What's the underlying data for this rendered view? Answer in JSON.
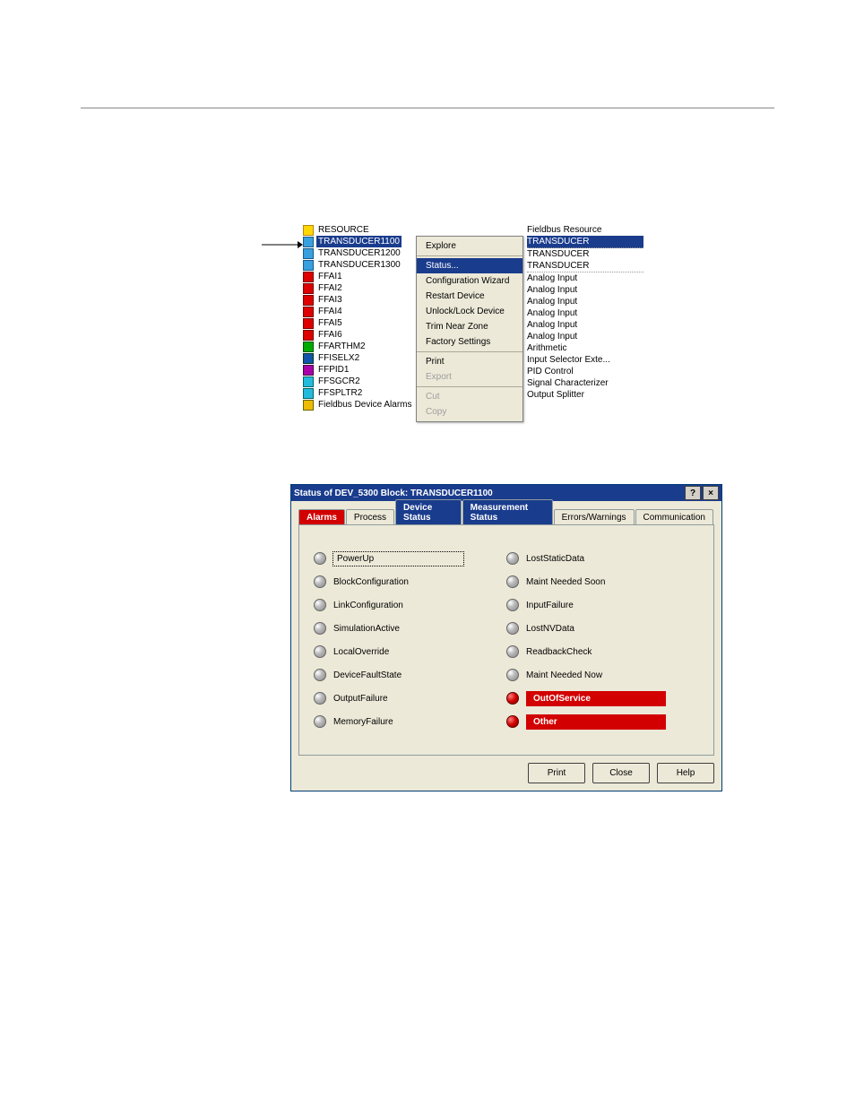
{
  "tree": {
    "items": [
      {
        "label": "RESOURCE",
        "icon": "ic-folder",
        "type": "Fieldbus Resource",
        "tsel": false,
        "sel": false,
        "dot": false
      },
      {
        "label": "TRANSDUCER1100",
        "icon": "ic-block",
        "type": "TRANSDUCER",
        "tsel": true,
        "sel": true,
        "dot": true
      },
      {
        "label": "TRANSDUCER1200",
        "icon": "ic-block",
        "type": "TRANSDUCER",
        "tsel": false,
        "sel": false,
        "dot": false
      },
      {
        "label": "TRANSDUCER1300",
        "icon": "ic-block",
        "type": "TRANSDUCER",
        "tsel": false,
        "sel": false,
        "dot": true
      },
      {
        "label": "FFAI1",
        "icon": "ic-func",
        "type": "Analog Input",
        "tsel": false,
        "sel": false,
        "dot": false
      },
      {
        "label": "FFAI2",
        "icon": "ic-func",
        "type": "Analog Input",
        "tsel": false,
        "sel": false,
        "dot": false
      },
      {
        "label": "FFAI3",
        "icon": "ic-func",
        "type": "Analog Input",
        "tsel": false,
        "sel": false,
        "dot": false
      },
      {
        "label": "FFAI4",
        "icon": "ic-func",
        "type": "Analog Input",
        "tsel": false,
        "sel": false,
        "dot": false
      },
      {
        "label": "FFAI5",
        "icon": "ic-func",
        "type": "Analog Input",
        "tsel": false,
        "sel": false,
        "dot": false
      },
      {
        "label": "FFAI6",
        "icon": "ic-func",
        "type": "Analog Input",
        "tsel": false,
        "sel": false,
        "dot": false
      },
      {
        "label": "FFARTHM2",
        "icon": "ic-g",
        "type": "Arithmetic",
        "tsel": false,
        "sel": false,
        "dot": false
      },
      {
        "label": "FFISELX2",
        "icon": "ic-b",
        "type": "Input Selector Exte...",
        "tsel": false,
        "sel": false,
        "dot": false
      },
      {
        "label": "FFPID1",
        "icon": "ic-l",
        "type": "PID Control",
        "tsel": false,
        "sel": false,
        "dot": false
      },
      {
        "label": "FFSGCR2",
        "icon": "ic-s",
        "type": "Signal Characterizer",
        "tsel": false,
        "sel": false,
        "dot": false
      },
      {
        "label": "FFSPLTR2",
        "icon": "ic-s",
        "type": "Output Splitter",
        "tsel": false,
        "sel": false,
        "dot": false
      },
      {
        "label": "Fieldbus Device Alarms",
        "icon": "ic-y",
        "type": "",
        "tsel": false,
        "sel": false,
        "dot": false
      }
    ]
  },
  "context_menu": {
    "sections": [
      [
        {
          "label": "Explore",
          "dis": false,
          "sel": false
        }
      ],
      [
        {
          "label": "Status...",
          "dis": false,
          "sel": true
        },
        {
          "label": "Configuration Wizard",
          "dis": false,
          "sel": false
        },
        {
          "label": "Restart Device",
          "dis": false,
          "sel": false
        },
        {
          "label": "Unlock/Lock Device",
          "dis": false,
          "sel": false
        },
        {
          "label": "Trim Near Zone",
          "dis": false,
          "sel": false
        },
        {
          "label": "Factory Settings",
          "dis": false,
          "sel": false
        }
      ],
      [
        {
          "label": "Print",
          "dis": false,
          "sel": false
        },
        {
          "label": "Export",
          "dis": true,
          "sel": false
        }
      ],
      [
        {
          "label": "Cut",
          "dis": true,
          "sel": false
        },
        {
          "label": "Copy",
          "dis": true,
          "sel": false
        }
      ]
    ]
  },
  "dialog": {
    "title": "Status of DEV_5300 Block: TRANSDUCER1100",
    "help_btn": "?",
    "close_btn": "×",
    "tabs": [
      {
        "label": "Alarms",
        "cls": "hl"
      },
      {
        "label": "Process",
        "cls": ""
      },
      {
        "label": "Device Status",
        "cls": "blue"
      },
      {
        "label": "Measurement Status",
        "cls": "blue"
      },
      {
        "label": "Errors/Warnings",
        "cls": ""
      },
      {
        "label": "Communication",
        "cls": ""
      }
    ],
    "left": [
      {
        "label": "PowerUp",
        "alert": false,
        "focus": true
      },
      {
        "label": "BlockConfiguration",
        "alert": false,
        "focus": false
      },
      {
        "label": "LinkConfiguration",
        "alert": false,
        "focus": false
      },
      {
        "label": "SimulationActive",
        "alert": false,
        "focus": false
      },
      {
        "label": "LocalOverride",
        "alert": false,
        "focus": false
      },
      {
        "label": "DeviceFaultState",
        "alert": false,
        "focus": false
      },
      {
        "label": "OutputFailure",
        "alert": false,
        "focus": false
      },
      {
        "label": "MemoryFailure",
        "alert": false,
        "focus": false
      }
    ],
    "right": [
      {
        "label": "LostStaticData",
        "alert": false
      },
      {
        "label": "Maint Needed Soon",
        "alert": false
      },
      {
        "label": "InputFailure",
        "alert": false
      },
      {
        "label": "LostNVData",
        "alert": false
      },
      {
        "label": "ReadbackCheck",
        "alert": false
      },
      {
        "label": "Maint Needed Now",
        "alert": false
      },
      {
        "label": "OutOfService",
        "alert": true
      },
      {
        "label": "Other",
        "alert": true
      }
    ],
    "buttons": {
      "print": "Print",
      "close": "Close",
      "help": "Help"
    }
  }
}
